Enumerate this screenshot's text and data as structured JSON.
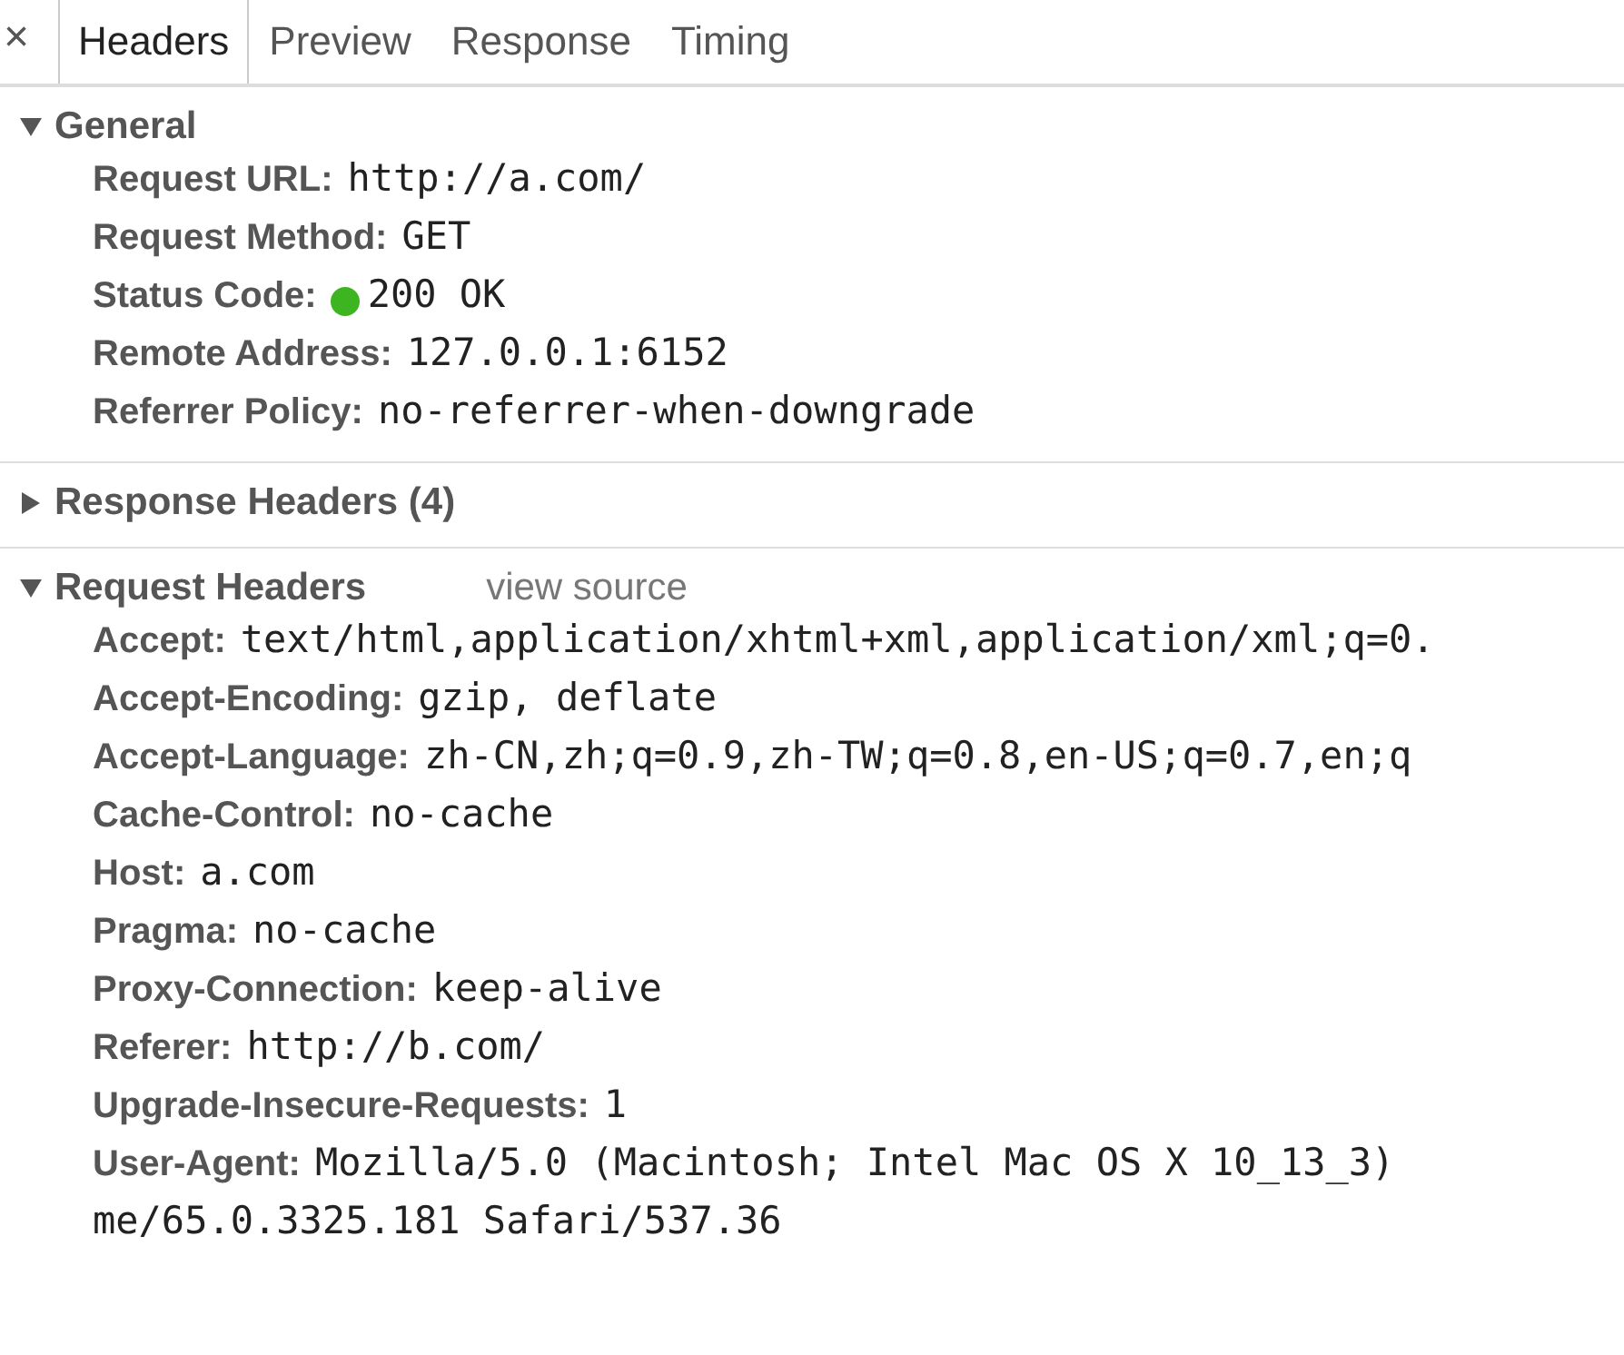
{
  "close_button": "×",
  "tabs": [
    {
      "label": "Headers",
      "selected": true
    },
    {
      "label": "Preview",
      "selected": false
    },
    {
      "label": "Response",
      "selected": false
    },
    {
      "label": "Timing",
      "selected": false
    }
  ],
  "sections": [
    {
      "title": "General",
      "expanded": true,
      "rows": [
        {
          "name": "Request URL:",
          "value": "http://a.com/"
        },
        {
          "name": "Request Method:",
          "value": "GET"
        },
        {
          "name": "Status Code:",
          "value": "200 OK",
          "color": "#3cb521"
        },
        {
          "name": "Remote Address:",
          "value": "127.0.0.1:6152"
        },
        {
          "name": "Referrer Policy:",
          "value": "no-referrer-when-downgrade"
        }
      ]
    },
    {
      "title": "Response Headers (4)",
      "expanded": false
    },
    {
      "title": "Request Headers",
      "expanded": true,
      "link": "view source",
      "rows": [
        {
          "name": "Accept:",
          "value": "text/html,application/xhtml+xml,application/xml;q=0."
        },
        {
          "name": "Accept-Encoding:",
          "value": "gzip, deflate"
        },
        {
          "name": "Accept-Language:",
          "value": "zh-CN,zh;q=0.9,zh-TW;q=0.8,en-US;q=0.7,en;q"
        },
        {
          "name": "Cache-Control:",
          "value": "no-cache"
        },
        {
          "name": "Host:",
          "value": "a.com"
        },
        {
          "name": "Pragma:",
          "value": "no-cache"
        },
        {
          "name": "Proxy-Connection:",
          "value": "keep-alive"
        },
        {
          "name": "Referer:",
          "value": "http://b.com/"
        },
        {
          "name": "Upgrade-Insecure-Requests:",
          "value": "1"
        },
        {
          "name": "User-Agent:",
          "value": "Mozilla/5.0 (Macintosh; Intel Mac OS X 10_13_3)",
          "continuation": "me/65.0.3325.181 Safari/537.36"
        }
      ]
    }
  ]
}
